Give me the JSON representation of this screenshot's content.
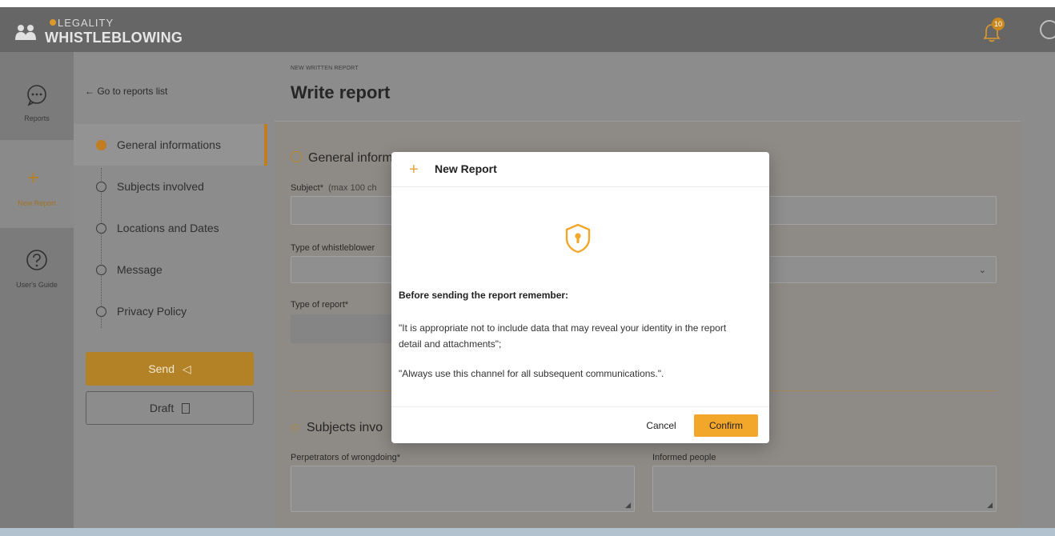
{
  "app": {
    "logo_top": "LEGALITY",
    "logo_bottom": "WHISTLEBLOWING",
    "notification_count": "10"
  },
  "rail": {
    "items": [
      {
        "label": "Reports",
        "icon": "chat-bubble-icon"
      },
      {
        "label": "New Report",
        "icon": "plus-icon"
      },
      {
        "label": "User's Guide",
        "icon": "help-circle-icon"
      }
    ]
  },
  "nav": {
    "back_label": "Go to reports list",
    "steps": [
      {
        "label": "General informations",
        "active": true
      },
      {
        "label": "Subjects involved"
      },
      {
        "label": "Locations and Dates"
      },
      {
        "label": "Message"
      },
      {
        "label": "Privacy Policy"
      }
    ],
    "send_label": "Send",
    "draft_label": "Draft"
  },
  "main": {
    "breadcrumb": "NEW WRITTEN REPORT",
    "title": "Write report",
    "section1_title": "General inform",
    "subject_label": "Subject*",
    "subject_hint": "(max 100 ch",
    "whistleblower_label": "Type of whistleblower",
    "report_type_label": "Type of report*",
    "section2_title": "Subjects invo",
    "perpetrators_label": "Perpetrators of wrongdoing*",
    "informed_label": "Informed people"
  },
  "modal": {
    "title": "New Report",
    "heading": "Before sending the report remember:",
    "p1": "\"It is appropriate not to include data that may reveal your identity in the report detail and attachments\";",
    "p2": "\"Always use this channel for all subsequent communications.\".",
    "cancel_label": "Cancel",
    "confirm_label": "Confirm"
  },
  "colors": {
    "accent": "#f2a72b",
    "header": "#666666",
    "overlay_page": "#8c8c8c"
  }
}
